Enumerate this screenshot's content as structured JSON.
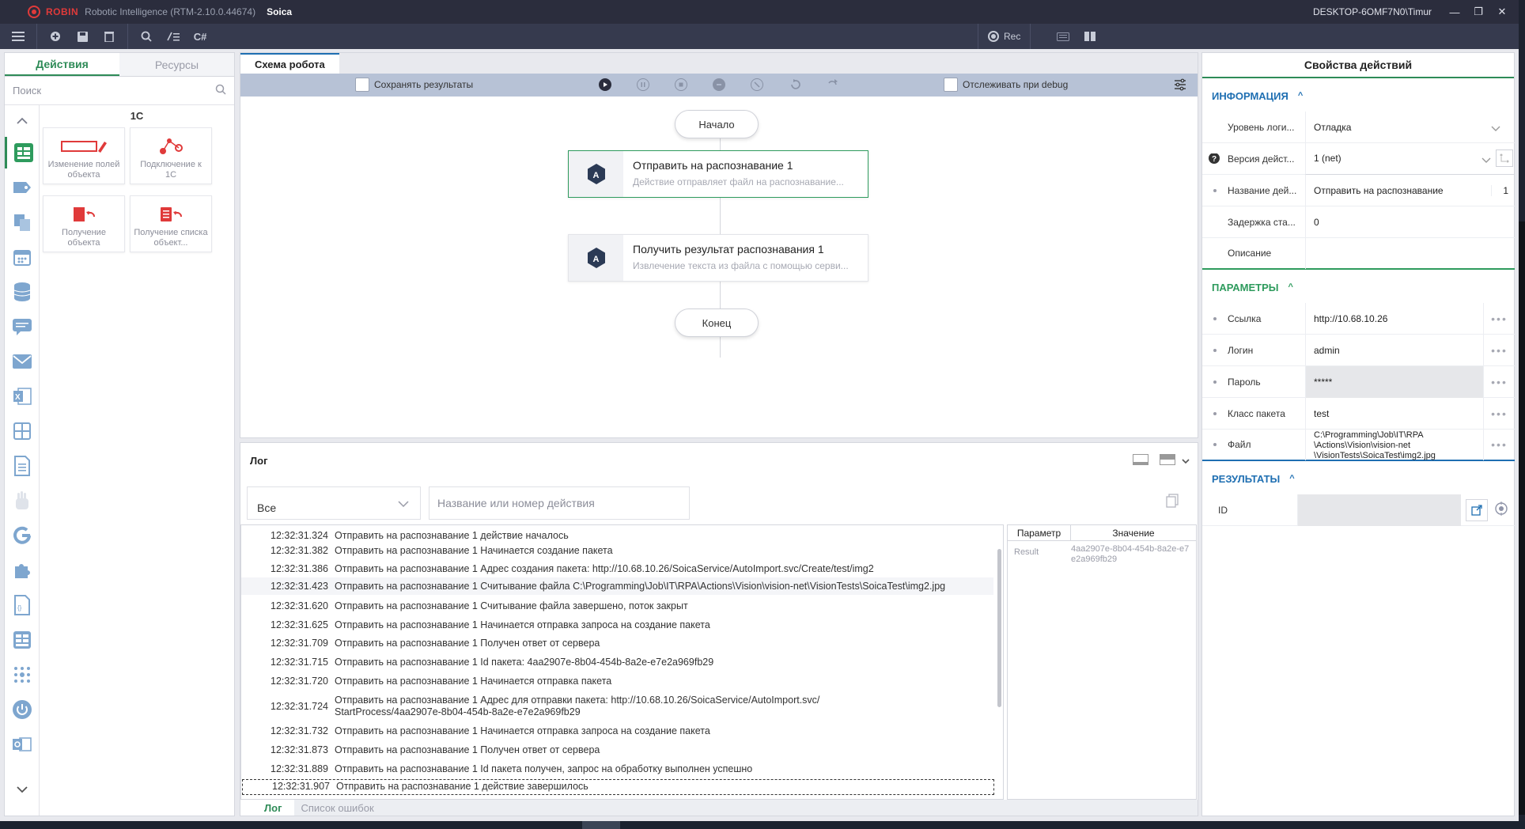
{
  "titlebar": {
    "brand": "ROBIN",
    "app": "Robotic Intelligence (RTM-2.10.0.44674)",
    "project": "Soica",
    "user": "DESKTOP-6OMF7N0\\Timur",
    "minimize": "—",
    "restore": "❐",
    "close": "✕"
  },
  "toolbar": {
    "csharp": "C#",
    "rec": "Rec"
  },
  "left_panel": {
    "tabs": [
      "Действия",
      "Ресурсы"
    ],
    "search_placeholder": "Поиск",
    "group": "1С",
    "actions": [
      {
        "label": "Изменение полей объекта"
      },
      {
        "label": "Подключение к 1С"
      },
      {
        "label": "Получение объекта"
      },
      {
        "label": "Получение списка объект..."
      }
    ]
  },
  "schema": {
    "tab": "Схема робота",
    "save_results": "Сохранять результаты",
    "debug_track": "Отслеживать при debug",
    "start": "Начало",
    "end": "Конец",
    "nodes": [
      {
        "title": "Отправить на распознавание  1",
        "desc": "Действие отправляет файл на распознавание..."
      },
      {
        "title": "Получить результат распознавания  1",
        "desc": "Извлечение текста из файла с помощью серви..."
      }
    ]
  },
  "log": {
    "title": "Лог",
    "filter_value": "Все",
    "search_placeholder": "Название или номер действия",
    "rows": [
      {
        "time": "12:32:31.324",
        "msg": "Отправить на распознавание 1 действие началось"
      },
      {
        "time": "12:32:31.382",
        "msg": "Отправить на распознавание 1 Начинается создание пакета"
      },
      {
        "time": "12:32:31.386",
        "msg": "Отправить на распознавание 1 Адрес создания пакета: http://10.68.10.26/SoicaService/AutoImport.svc/Create/test/img2"
      },
      {
        "time": "12:32:31.423",
        "msg": "Отправить на распознавание 1 Считывание файла C:\\Programming\\Job\\IT\\RPA\\Actions\\Vision\\vision-net\\VisionTests\\SoicaTest\\img2.jpg"
      },
      {
        "time": "12:32:31.620",
        "msg": "Отправить на распознавание 1 Считывание файла завершено, поток закрыт"
      },
      {
        "time": "12:32:31.625",
        "msg": "Отправить на распознавание 1 Начинается отправка запроса на создание пакета"
      },
      {
        "time": "12:32:31.709",
        "msg": "Отправить на распознавание 1 Получен ответ от сервера"
      },
      {
        "time": "12:32:31.715",
        "msg": "Отправить на распознавание 1 Id пакета: 4aa2907e-8b04-454b-8a2e-e7e2a969fb29"
      },
      {
        "time": "12:32:31.720",
        "msg": "Отправить на распознавание 1 Начинается отправка пакета"
      },
      {
        "time": "12:32:31.724",
        "msg": "Отправить на распознавание 1 Адрес для отправки пакета: http://10.68.10.26/SoicaService/AutoImport.svc/",
        "msg2": "StartProcess/4aa2907e-8b04-454b-8a2e-e7e2a969fb29"
      },
      {
        "time": "12:32:31.732",
        "msg": "Отправить на распознавание 1 Начинается отправка запроса на создание пакета"
      },
      {
        "time": "12:32:31.873",
        "msg": "Отправить на распознавание 1 Получен ответ от сервера"
      },
      {
        "time": "12:32:31.889",
        "msg": "Отправить на распознавание 1 Id пакета получен, запрос на обработку выполнен успешно"
      },
      {
        "time": "12:32:31.907",
        "msg": "Отправить на распознавание 1 действие завершилось"
      }
    ],
    "param_header": "Параметр",
    "value_header": "Значение",
    "param_name": "Result",
    "param_value": "4aa2907e-8b04-454b-8a2e-e7e2a969fb29",
    "tabs": [
      "Лог",
      "Список ошибок"
    ]
  },
  "properties": {
    "title": "Свойства действий",
    "info_section": "ИНФОРМАЦИЯ",
    "log_level_label": "Уровень логи...",
    "log_level_value": "Отладка",
    "version_label": "Версия дейст...",
    "version_value": "1 (net)",
    "name_label": "Название дей...",
    "name_value": "Отправить на распознавание",
    "name_num": "1",
    "delay_label": "Задержка ста...",
    "delay_value": "0",
    "desc_label": "Описание",
    "params_section": "ПАРАМЕТРЫ",
    "link_label": "Ссылка",
    "link_value": "http://10.68.10.26",
    "login_label": "Логин",
    "login_value": "admin",
    "password_label": "Пароль",
    "password_value": "*****",
    "class_label": "Класс пакета",
    "class_value": "test",
    "file_label": "Файл",
    "file_value_1": "C:\\Programming\\Job\\IT\\RPA",
    "file_value_2": "\\Actions\\Vision\\vision-net",
    "file_value_3": "\\VisionTests\\SoicaTest\\img2.jpg",
    "results_section": "РЕЗУЛЬТАТЫ",
    "id_label": "ID",
    "more": "•••"
  }
}
